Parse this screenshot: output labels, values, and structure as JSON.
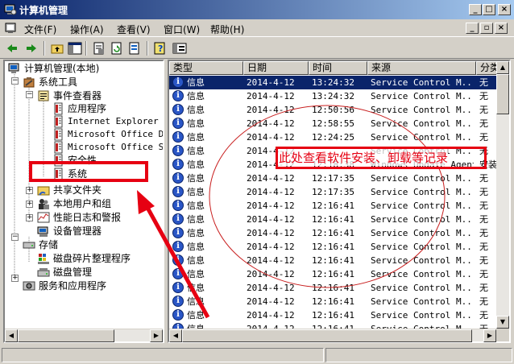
{
  "window": {
    "title": "计算机管理",
    "controls": [
      "_",
      "□",
      "×"
    ]
  },
  "menubar": {
    "items": [
      "文件(F)",
      "操作(A)",
      "查看(V)",
      "窗口(W)",
      "帮助(H)"
    ],
    "mdi_controls": [
      "_",
      "▫",
      "×"
    ]
  },
  "toolbar": {
    "buttons": [
      "back-icon",
      "forward-icon",
      "up-folder-icon",
      "show-tree-icon",
      "properties-icon",
      "refresh-icon",
      "export-icon",
      "help-icon",
      "console-icon"
    ]
  },
  "tree": {
    "nodes": [
      {
        "label": "计算机管理(本地)",
        "icon": "computer-icon"
      },
      {
        "label": "系统工具",
        "icon": "tools-icon"
      },
      {
        "label": "事件查看器",
        "icon": "event-viewer-icon"
      },
      {
        "label": "应用程序",
        "icon": "log-icon"
      },
      {
        "label": "Internet Explorer",
        "icon": "log-icon"
      },
      {
        "label": "Microsoft Office Di",
        "icon": "log-icon"
      },
      {
        "label": "Microsoft Office Se",
        "icon": "log-icon"
      },
      {
        "label": "安全性",
        "icon": "log-icon"
      },
      {
        "label": "系统",
        "icon": "log-icon"
      },
      {
        "label": "共享文件夹",
        "icon": "shared-folder-icon"
      },
      {
        "label": "本地用户和组",
        "icon": "users-icon"
      },
      {
        "label": "性能日志和警报",
        "icon": "performance-icon"
      },
      {
        "label": "设备管理器",
        "icon": "device-manager-icon"
      },
      {
        "label": "存储",
        "icon": "storage-icon"
      },
      {
        "label": "磁盘碎片整理程序",
        "icon": "defrag-icon"
      },
      {
        "label": "磁盘管理",
        "icon": "disk-icon"
      },
      {
        "label": "服务和应用程序",
        "icon": "services-icon"
      }
    ]
  },
  "list": {
    "columns": [
      "类型",
      "日期",
      "时间",
      "来源",
      "分类"
    ],
    "rows": [
      [
        "信息",
        "2014-4-12",
        "13:24:32",
        "Service Control M...",
        "无"
      ],
      [
        "信息",
        "2014-4-12",
        "13:24:32",
        "Service Control M...",
        "无"
      ],
      [
        "信息",
        "2014-4-12",
        "12:50:56",
        "Service Control M...",
        "无"
      ],
      [
        "信息",
        "2014-4-12",
        "12:58:55",
        "Service Control M...",
        "无"
      ],
      [
        "信息",
        "2014-4-12",
        "12:24:25",
        "Service Control M...",
        "无"
      ],
      [
        "信息",
        "2014-4-12",
        "",
        "Service Control M...",
        "无"
      ],
      [
        "信息",
        "2014-4-12",
        "12:18:38",
        "Windows Update Agent",
        "安装"
      ],
      [
        "信息",
        "2014-4-12",
        "12:17:35",
        "Service Control M...",
        "无"
      ],
      [
        "信息",
        "2014-4-12",
        "12:17:35",
        "Service Control M...",
        "无"
      ],
      [
        "信息",
        "2014-4-12",
        "12:16:41",
        "Service Control M...",
        "无"
      ],
      [
        "信息",
        "2014-4-12",
        "12:16:41",
        "Service Control M...",
        "无"
      ],
      [
        "信息",
        "2014-4-12",
        "12:16:41",
        "Service Control M...",
        "无"
      ],
      [
        "信息",
        "2014-4-12",
        "12:16:41",
        "Service Control M...",
        "无"
      ],
      [
        "信息",
        "2014-4-12",
        "12:16:41",
        "Service Control M...",
        "无"
      ],
      [
        "信息",
        "2014-4-12",
        "12:16:41",
        "Service Control M...",
        "无"
      ],
      [
        "信息",
        "2014-4-12",
        "12:16:41",
        "Service Control M...",
        "无"
      ],
      [
        "信息",
        "2014-4-12",
        "12:16:41",
        "Service Control M...",
        "无"
      ],
      [
        "信息",
        "2014-4-12",
        "12:16:41",
        "Service Control M...",
        "无"
      ],
      [
        "信息",
        "2014-4-12",
        "12:16:41",
        "Service Control M...",
        "无"
      ]
    ]
  },
  "annotation": {
    "text": "此处查看软件安装、卸载等记录",
    "color": "#e60012"
  },
  "colors": {
    "selection": "#0a246a",
    "title_start": "#0a246a",
    "title_end": "#a6caf0",
    "face": "#d4d0c8"
  }
}
